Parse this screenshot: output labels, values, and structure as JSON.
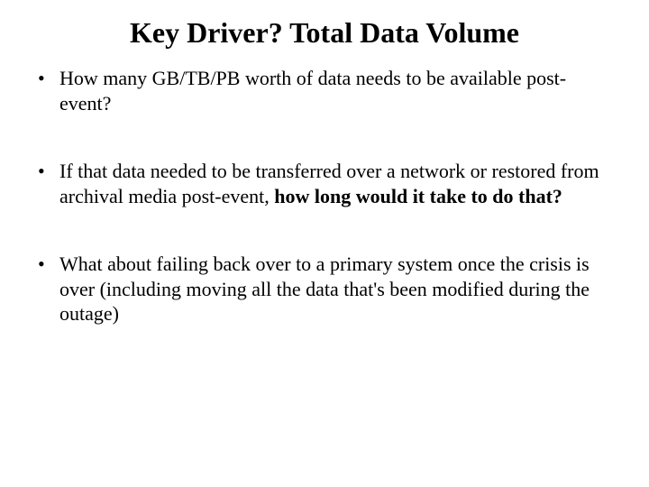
{
  "slide": {
    "title": "Key Driver? Total Data Volume",
    "bullets": [
      {
        "pre": "How many GB/TB/PB worth of data needs to be available post-event?",
        "bold": "",
        "post": ""
      },
      {
        "pre": "If that data needed to be transferred over a network or restored from archival media post-event, ",
        "bold": "how long would it take to do that?",
        "post": ""
      },
      {
        "pre": "What about failing back over to a primary system once the crisis is over (including moving all the data that's been modified during the outage)",
        "bold": "",
        "post": ""
      }
    ]
  }
}
